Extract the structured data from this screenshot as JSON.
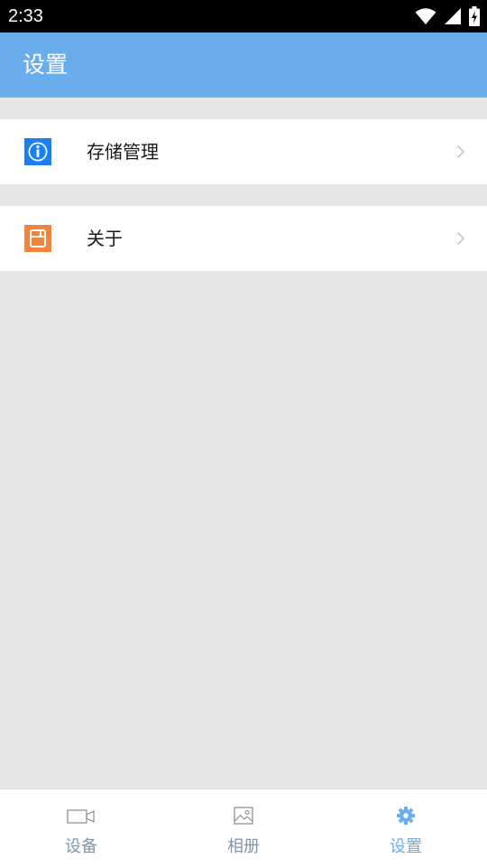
{
  "status_bar": {
    "time": "2:33",
    "icons": [
      "wifi-icon",
      "signal-icon",
      "battery-charging-icon"
    ]
  },
  "app_bar": {
    "title": "设置",
    "background": "#6aaded"
  },
  "settings": {
    "items": [
      {
        "label": "存储管理",
        "icon": "info-icon",
        "icon_color": "#1a7ff0"
      },
      {
        "label": "关于",
        "icon": "about-icon",
        "icon_color": "#f0843c"
      }
    ]
  },
  "tab_bar": {
    "items": [
      {
        "label": "设备",
        "icon": "video-camera-icon",
        "active": false
      },
      {
        "label": "相册",
        "icon": "image-icon",
        "active": false
      },
      {
        "label": "设置",
        "icon": "gear-icon",
        "active": true
      }
    ],
    "active_color": "#6aaded",
    "inactive_color": "#7f96ad"
  }
}
